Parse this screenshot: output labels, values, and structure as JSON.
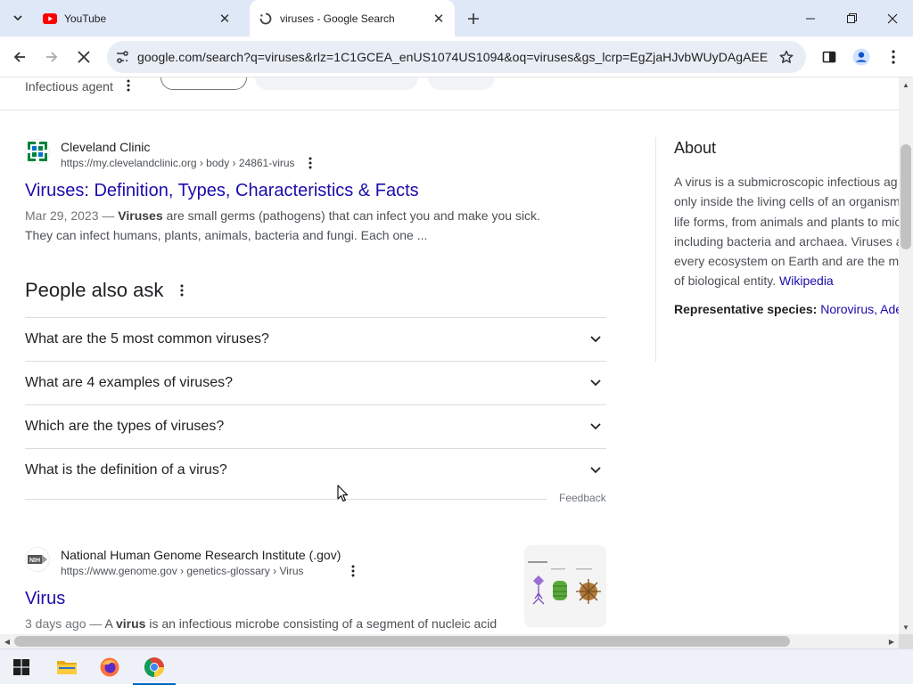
{
  "browser": {
    "tabs": [
      {
        "title": "YouTube",
        "favicon": "youtube-icon",
        "active": false
      },
      {
        "title": "viruses - Google Search",
        "favicon": "loading-spinner-icon",
        "active": true
      }
    ],
    "url": "google.com/search?q=viruses&rlz=1C1GCEA_enUS1074US1094&oq=viruses&gs_lcrp=EgZjaHJvbWUyDAgAEEUY..."
  },
  "header": {
    "entity_label": "Infectious agent"
  },
  "result1": {
    "site_name": "Cleveland Clinic",
    "url_path": "https://my.clevelandclinic.org › body › 24861-virus",
    "title": "Viruses: Definition, Types, Characteristics & Facts",
    "date": "Mar 29, 2023 —",
    "bold_term": "Viruses",
    "snippet_line1_rest": " are small germs (pathogens) that can infect you and make you sick.",
    "snippet_line2": "They can infect humans, plants, animals, bacteria and fungi. Each one ..."
  },
  "paa": {
    "heading": "People also ask",
    "questions": [
      "What are the 5 most common viruses?",
      "What are 4 examples of viruses?",
      "Which are the types of viruses?",
      "What is the definition of a virus?"
    ],
    "feedback": "Feedback"
  },
  "result2": {
    "site_name": "National Human Genome Research Institute (.gov)",
    "url_path": "https://www.genome.gov › genetics-glossary › Virus",
    "title": "Virus",
    "date": "3 days ago —",
    "snippet_pre": " A ",
    "bold_term": "virus",
    "snippet_rest": " is an infectious microbe consisting of a segment of nucleic acid"
  },
  "knowledge_panel": {
    "heading": "About",
    "desc_lines": [
      "A virus is a submicroscopic infectious ag",
      "only inside the living cells of an organism",
      "life forms, from animals and plants to mic",
      "including bacteria and archaea. Viruses a",
      "every ecosystem on Earth and are the m"
    ],
    "desc_last_prefix": "of biological entity. ",
    "wiki_link": "Wikipedia",
    "species_label": "Representative species:",
    "species_links": " Norovirus, Ade"
  },
  "colors": {
    "link": "#1a0dab",
    "tabstrip": "#dfe8f7",
    "omnibox": "#e9eef6"
  }
}
